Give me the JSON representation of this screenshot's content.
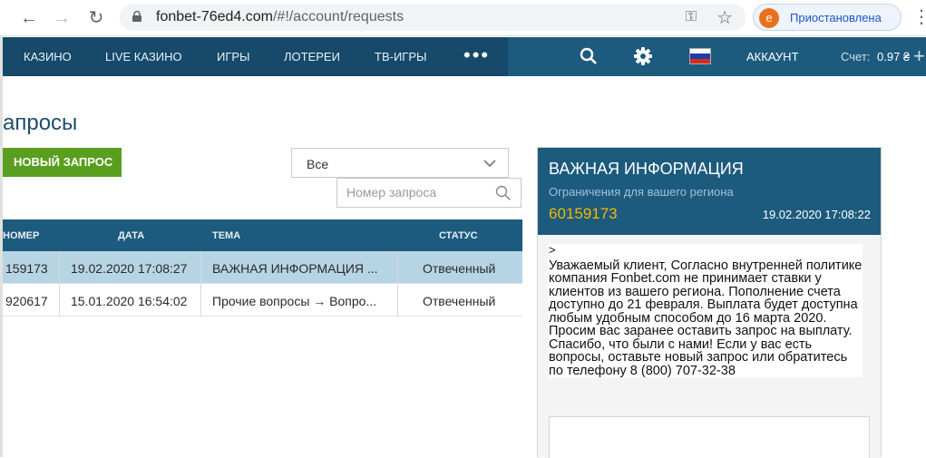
{
  "browser": {
    "url_host": "fonbet-76ed4.com",
    "url_path": "/#!/account/requests",
    "profile_initial": "e",
    "profile_status": "Приостановлена"
  },
  "nav": {
    "items": [
      "КАЗИНО",
      "LIVE КАЗИНО",
      "ИГРЫ",
      "ЛОТЕРЕИ",
      "ТВ-ИГРЫ"
    ],
    "more": "•••",
    "account": "АККАУНТ",
    "balance_label": "Счет:",
    "balance_value": "0.97 ₴",
    "plus": "+"
  },
  "page": {
    "title": "апросы"
  },
  "actions": {
    "new_request": "НОВЫЙ ЗАПРОС",
    "filter_value": "Все",
    "search_placeholder": "Номер запроса"
  },
  "table": {
    "headers": [
      "НОМЕР",
      "ДАТА",
      "ТЕМА",
      "СТАТУС"
    ],
    "rows": [
      {
        "number": "159173",
        "date": "19.02.2020 17:08:27",
        "topic": "ВАЖНАЯ ИНФОРМАЦИЯ ...",
        "status": "Отвеченный"
      },
      {
        "number": "920617",
        "date": "15.01.2020 16:54:02",
        "topic": "Прочие вопросы → Вопро...",
        "status": "Отвеченный"
      }
    ]
  },
  "panel": {
    "title": "ВАЖНАЯ ИНФОРМАЦИЯ",
    "subtitle": "Ограничения для вашего региона",
    "number": "60159173",
    "date": "19.02.2020 17:08:22",
    "arrow": ">",
    "message": "Уважаемый клиент, Согласно внутренней политике компания Fonbet.com не принимает ставки у клиентов из вашего региона. Пополнение счета доступно до 21 февраля. Выплата будет доступна любым удобным способом до 16 марта 2020. Просим вас заранее оставить запрос на выплату. Спасибо, что были с нами! Если у вас есть вопросы, оставьте новый запрос или обратитесь по телефону 8 (800) 707-32-38"
  },
  "colors": {
    "nav_dark": "#16496a",
    "nav": "#1d5b7e",
    "accent_green": "#5a9e1f",
    "number_yellow": "#f5b800",
    "selected_row": "#b7d4e4"
  }
}
